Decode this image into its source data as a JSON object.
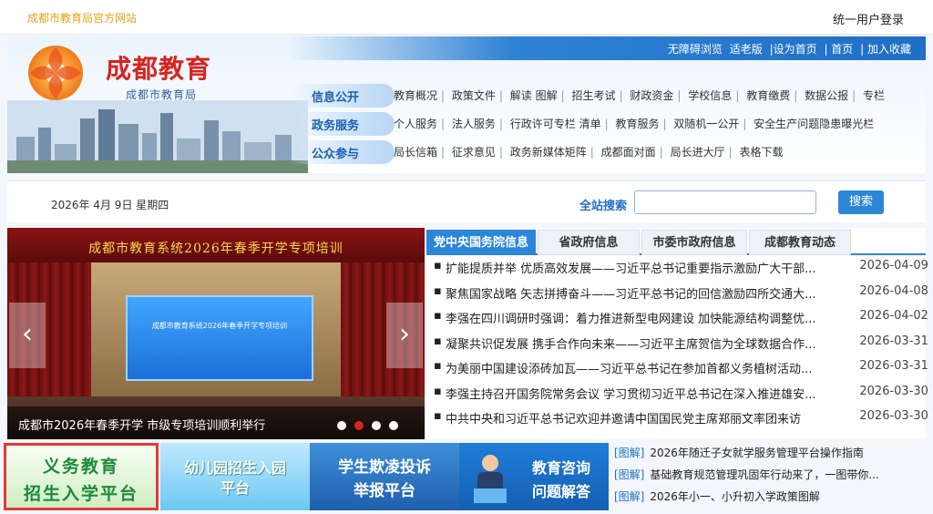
{
  "topbar": {
    "site_name": "成都市教育局官方网站",
    "login": "统一用户登录"
  },
  "header": {
    "quicklinks": [
      "无障碍浏览",
      "适老版",
      "|设为首页",
      "| 首页",
      "| 加入收藏"
    ],
    "brand": "成都教育",
    "brand_sub": "成都市教育局",
    "nav_tabs": [
      "信息公开",
      "政务服务",
      "公众参与"
    ],
    "nav_rows": [
      [
        "教育概况",
        "政策文件",
        "解读",
        "图解",
        "招生考试",
        "财政资金",
        "学校信息",
        "教育缴费",
        "数据公报",
        "专栏"
      ],
      [
        "个人服务",
        "法人服务",
        "行政许可专栏",
        "清单",
        "教育服务",
        "双随机一公开",
        "安全生产问题隐患曝光栏"
      ],
      [
        "局长信箱",
        "征求意见",
        "政务新媒体矩阵",
        "成都面对面",
        "局长进大厅",
        "表格下载"
      ]
    ]
  },
  "searchbar": {
    "date": "2026年 4月 9日 星期四",
    "label": "全站搜索",
    "input_value": "",
    "button": "搜索"
  },
  "carousel": {
    "banner": "成都市教育系统2026年春季开学专项培训",
    "screen_title": "成都市教育系统2026年春季开学专项培训",
    "caption": "成都市2026年春季开学 市级专项培训顺利举行",
    "prev": "‹",
    "next": "›",
    "active_dot": 1
  },
  "news": {
    "tabs": [
      "党中央国务院信息",
      "省政府信息",
      "市委市政府信息",
      "成都教育动态"
    ],
    "items": [
      {
        "title": "扩能提质并举 优质高效发展——习近平总书记重要指示激励广大干部...",
        "date": "2026-04-09"
      },
      {
        "title": "聚焦国家战略 矢志拼搏奋斗——习近平总书记的回信激励四所交通大...",
        "date": "2026-04-08"
      },
      {
        "title": "李强在四川调研时强调：着力推进新型电网建设 加快能源结构调整优...",
        "date": "2026-04-02"
      },
      {
        "title": "凝聚共识促发展 携手合作向未来——习近平主席贺信为全球数据合作...",
        "date": "2026-03-31"
      },
      {
        "title": "为美丽中国建设添砖加瓦——习近平总书记在参加首都义务植树活动...",
        "date": "2026-03-31"
      },
      {
        "title": "李强主持召开国务院常务会议 学习贯彻习近平总书记在深入推进雄安...",
        "date": "2026-03-30"
      },
      {
        "title": "中共中央和习近平总书记欢迎并邀请中国国民党主席郑丽文率团来访",
        "date": "2026-03-30"
      }
    ]
  },
  "tiles": {
    "t1": [
      "义务教育",
      "招生入学平台"
    ],
    "t2": [
      "幼儿园招生入园",
      "平台"
    ],
    "t3": [
      "学生欺凌投诉",
      "举报平台"
    ],
    "t4": [
      "教育咨询",
      "问题解答"
    ]
  },
  "tujie": {
    "tag": "[图解]",
    "items": [
      "2026年随迁子女就学服务管理平台操作指南",
      "基础教育规范管理巩固年行动来了，一图带你...",
      "2026年小一、小升初入学政策图解"
    ]
  },
  "colors": {
    "brand_red": "#d8231e",
    "primary_blue": "#2b86d8",
    "highlight_border": "#e53935"
  }
}
